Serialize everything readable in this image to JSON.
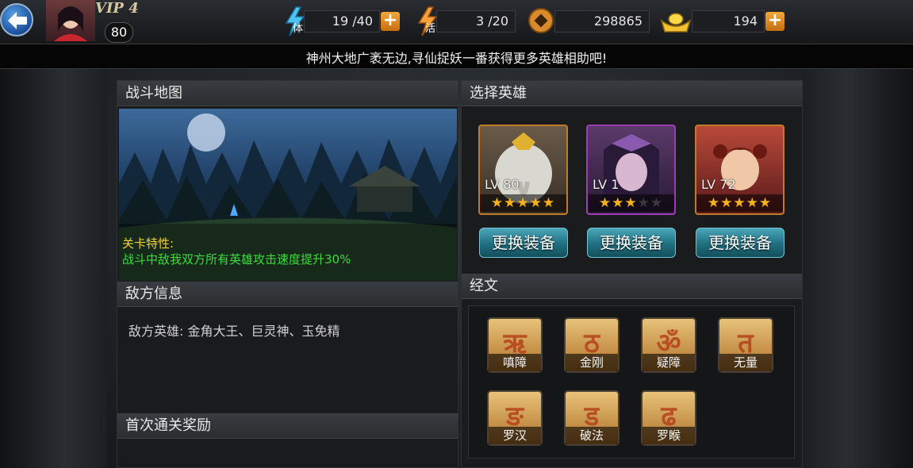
{
  "player": {
    "vip": "VIP 4",
    "level": "80"
  },
  "resources": {
    "stamina": {
      "value": "19 /40",
      "icon_text": "体"
    },
    "vigor": {
      "value": "3 /20",
      "icon_text": "活"
    },
    "coins": {
      "value": "298865"
    },
    "gold": {
      "value": "194"
    }
  },
  "ticker": "神州大地广袤无边,寻仙捉妖一番获得更多英雄相助吧!",
  "battle_map": {
    "title": "战斗地图",
    "feature_title": "关卡特性:",
    "feature_desc": "战斗中敌我双方所有英雄攻击速度提升30%"
  },
  "enemy": {
    "title": "敌方信息",
    "text": "敌方英雄: 金角大王、巨灵神、玉免精"
  },
  "first_reward": {
    "title": "首次通关奖励"
  },
  "select_hero": {
    "title": "选择英雄",
    "heroes": [
      {
        "level": "LV 80",
        "stars": 5,
        "max_stars": 5
      },
      {
        "level": "LV 1",
        "stars": 3,
        "max_stars": 5
      },
      {
        "level": "LV 72",
        "stars": 5,
        "max_stars": 5
      }
    ],
    "equip_label": "更换装备"
  },
  "scriptures": {
    "title": "经文",
    "items": [
      {
        "label": "嗔障",
        "glyph": "ऋ"
      },
      {
        "label": "金刚",
        "glyph": "ठ"
      },
      {
        "label": "疑障",
        "glyph": "ॐ"
      },
      {
        "label": "无量",
        "glyph": "त"
      },
      {
        "label": "罗汉",
        "glyph": "ङ"
      },
      {
        "label": "破法",
        "glyph": "ड"
      },
      {
        "label": "罗睺",
        "glyph": "ढ"
      }
    ]
  },
  "colors": {
    "accent_gold": "#f7b21c",
    "feature_green": "#3cdc3c",
    "feature_yellow": "#f2d23a",
    "button_teal": "#1f6f80"
  }
}
